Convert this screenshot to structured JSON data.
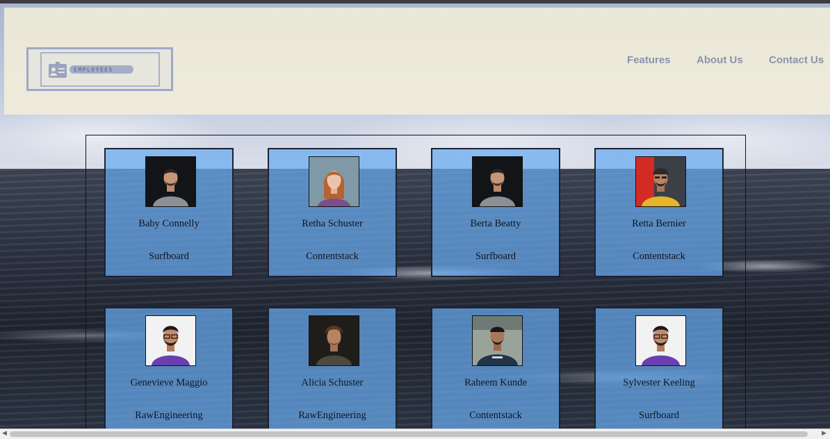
{
  "header": {
    "logo_text": "EMPLOYEES",
    "nav": [
      "Features",
      "About Us",
      "Contact Us"
    ]
  },
  "employees": [
    {
      "name": "Baby Connelly",
      "company": "Surfboard",
      "avatar": "man-gray-shirt-dark"
    },
    {
      "name": "Retha Schuster",
      "company": "Contentstack",
      "avatar": "woman-red-hair"
    },
    {
      "name": "Berta Beatty",
      "company": "Surfboard",
      "avatar": "man-gray-shirt-dark"
    },
    {
      "name": "Retta Bernier",
      "company": "Contentstack",
      "avatar": "man-yellow-shirt-red-bg"
    },
    {
      "name": "Genevieve Maggio",
      "company": "RawEngineering",
      "avatar": "man-glasses-purple-shirt"
    },
    {
      "name": "Alicia Schuster",
      "company": "RawEngineering",
      "avatar": "man-curly-hair-dark"
    },
    {
      "name": "Raheem Kunde",
      "company": "Contentstack",
      "avatar": "man-gym-navy-shirt"
    },
    {
      "name": "Sylvester Keeling",
      "company": "Surfboard",
      "avatar": "man-glasses-purple-shirt"
    }
  ],
  "colors": {
    "card_bg": "#68aaf0",
    "header_bg": "#f2eeda",
    "nav_text": "#8a93aa"
  }
}
